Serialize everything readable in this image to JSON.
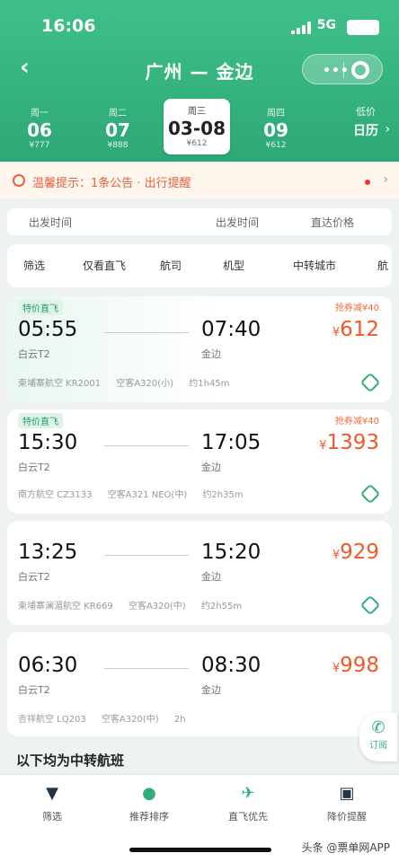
{
  "status": {
    "time": "16:06",
    "network": "5G"
  },
  "nav": {
    "title": "广州 — 金边",
    "back": "‹",
    "capsule_dots": "•••"
  },
  "dates": [
    {
      "weekday": "周一",
      "day": "06",
      "price": "¥777"
    },
    {
      "weekday": "周二",
      "day": "07",
      "price": "¥888"
    },
    {
      "weekday": "周三",
      "day": "03-08",
      "price": "¥612",
      "active": true
    },
    {
      "weekday": "周四",
      "day": "09",
      "price": "¥612"
    }
  ],
  "calendar": {
    "line1": "低价",
    "line2": "日历"
  },
  "notice": {
    "text": "温馨提示：1条公告 · 出行提醒"
  },
  "sort": {
    "dep_time": "出发时间",
    "arr_time": "出发时间",
    "direct_price": "直达价格"
  },
  "filters": [
    "筛选",
    "仅看直飞",
    "航司",
    "机型",
    "中转城市",
    "航"
  ],
  "flights": [
    {
      "tag": "特价直飞",
      "promo": "抢券减¥40",
      "dep": "05:55",
      "arr": "07:40",
      "dep_airport": "白云T2",
      "arr_airport": "金边",
      "price": "612",
      "meta": [
        "柬埔寨航空 KR2001",
        "空客A320(小)",
        "约1h45m"
      ]
    },
    {
      "tag": "特价直飞",
      "promo": "抢券减¥40",
      "dep": "15:30",
      "arr": "17:05",
      "dep_airport": "白云T2",
      "arr_airport": "金边",
      "price": "1393",
      "meta": [
        "南方航空 CZ3133",
        "空客A321 NEO(中)",
        "约2h35m"
      ]
    },
    {
      "tag": "",
      "promo": "",
      "dep": "13:25",
      "arr": "15:20",
      "dep_airport": "白云T2",
      "arr_airport": "金边",
      "price": "929",
      "meta": [
        "柬埔寨澜湄航空 KR669",
        "空客A320(中)",
        "约2h55m"
      ]
    },
    {
      "tag": "",
      "promo": "",
      "dep": "06:30",
      "arr": "08:30",
      "dep_airport": "白云T2",
      "arr_airport": "金边",
      "price": "998",
      "meta": [
        "吉祥航空 LQ203",
        "空客A320(中)",
        "2h"
      ]
    }
  ],
  "section_title": "以下均为中转航班",
  "float_button": {
    "label": "订阅"
  },
  "tabs": [
    {
      "icon": "filter-icon",
      "label": "筛选"
    },
    {
      "icon": "sort-icon",
      "label": "推荐排序"
    },
    {
      "icon": "plane-icon",
      "label": "直飞优先"
    },
    {
      "icon": "alert-icon",
      "label": "降价提醒"
    }
  ],
  "watermark": "头条 @票单网APP",
  "colors": {
    "brand": "#34b27e",
    "price": "#ee5a2a",
    "notice": "#e5623c"
  }
}
